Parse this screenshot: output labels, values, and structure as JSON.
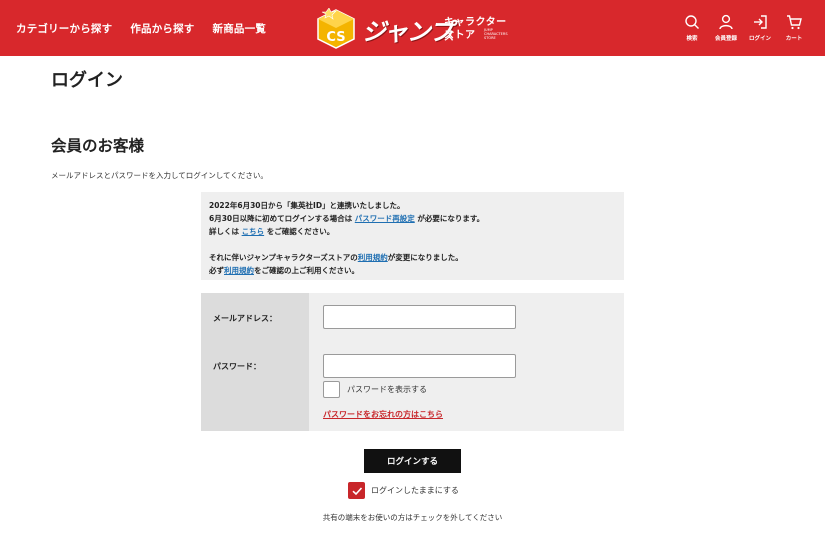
{
  "header": {
    "nav": [
      {
        "label": "カテゴリーから探す"
      },
      {
        "label": "作品から探す"
      },
      {
        "label": "新商品一覧"
      }
    ],
    "logo": {
      "mark": "CS",
      "text": "ジャンプ",
      "sub1": "キャラクターズ",
      "sub2": "ストア",
      "sub3": "JUMP CHARACTERS STORE"
    },
    "icons": [
      {
        "icon": "search-icon",
        "label": "検索"
      },
      {
        "icon": "user-icon",
        "label": "会員登録"
      },
      {
        "icon": "login-icon",
        "label": "ログイン"
      },
      {
        "icon": "cart-icon",
        "label": "カート"
      }
    ],
    "colors": {
      "header_bg": "#d8282c",
      "accent": "#c8262a",
      "link": "#1f6fb2"
    }
  },
  "page_title": "ログイン",
  "section_title": "会員のお客様",
  "intro": "メールアドレスとパスワードを入力してログインしてください。",
  "notice": {
    "line1": "2022年6月30日から「集英社ID」と連携いたしました。",
    "line2_pre": "6月30日以降に初めてログインする場合は ",
    "line2_link": "パスワード再設定",
    "line2_post": " が必要になります。",
    "line3_pre": "詳しくは ",
    "line3_link": "こちら",
    "line3_post": " をご確認ください。",
    "line4_pre": "それに伴いジャンプキャラクターズストアの",
    "line4_link": "利用規約",
    "line4_post": "が変更になりました。",
    "line5_pre": "必ず",
    "line5_link": "利用規約",
    "line5_post": "をご確認の上ご利用ください。"
  },
  "form": {
    "email_label": "メールアドレス：",
    "email_value": "",
    "password_label": "パスワード：",
    "password_value": "",
    "show_password_label": "パスワードを表示する",
    "show_password_checked": false,
    "forgot_link": "パスワードをお忘れの方はこちら"
  },
  "login_button": "ログインする",
  "remember": {
    "label": "ログインしたままにする",
    "checked": true
  },
  "shared_note": "共有の端末をお使いの方はチェックを外してください"
}
